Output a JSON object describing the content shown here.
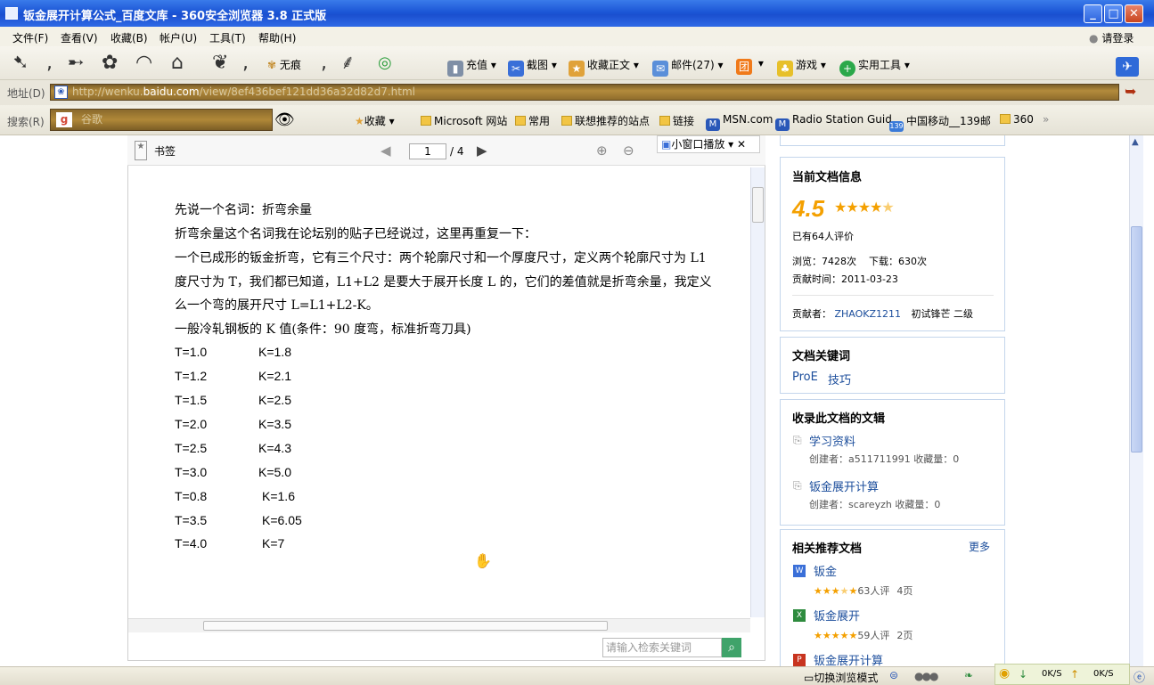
{
  "window": {
    "title": "钣金展开计算公式_百度文库 - 360安全浏览器 3.8 正式版",
    "minimize": "_",
    "maximize": "□",
    "close": "✕"
  },
  "menu": {
    "items": [
      "文件(F)",
      "查看(V)",
      "收藏(B)",
      "帐户(U)",
      "工具(T)",
      "帮助(H)"
    ],
    "login": "请登录"
  },
  "toolbar": {
    "no_trace": "无痕",
    "items": [
      "充值",
      "截图",
      "收藏正文",
      "邮件(27)",
      "团",
      "游戏",
      "实用工具"
    ]
  },
  "address": {
    "label": "地址(D)",
    "url_prefix": "http://wenku.",
    "url_host": "baidu.com",
    "url_path": "/view/8ef436bef121dd36a32d82d7.html"
  },
  "search": {
    "label": "搜索(R)",
    "engine": "谷歌"
  },
  "favorites": {
    "add": "收藏",
    "items": [
      "Microsoft 网站",
      "常用",
      "联想推荐的站点",
      "链接",
      "MSN.com",
      "Radio Station Guid",
      "中国移动__139邮",
      "360"
    ],
    "more": "»"
  },
  "doc_viewer": {
    "bookmark": "书签",
    "page_current": "1",
    "page_total": "/ 4",
    "mini_window": "小窗口播放",
    "search_placeholder": "请输入检索关键词",
    "lines": [
      "先说一个名词：折弯余量",
      "折弯余量这个名词我在论坛别的贴子已经说过，这里再重复一下：",
      "一个已成形的钣金折弯，它有三个尺寸：两个轮廓尺寸和一个厚度尺寸，定义两个轮廓尺寸为 L1",
      "度尺寸为 T，我们都已知道，L1+L2 是要大于展开长度 L 的，它们的差值就是折弯余量，我定义",
      "么一个弯的展开尺寸 L=L1+L2-K。",
      "一般冷轧钢板的 K 值(条件：90 度弯，标准折弯刀具)"
    ],
    "k_table": [
      {
        "t": "T=1.0",
        "k": "K=1.8"
      },
      {
        "t": "T=1.2",
        "k": "K=2.1"
      },
      {
        "t": "T=1.5",
        "k": "K=2.5"
      },
      {
        "t": "T=2.0",
        "k": "K=3.5"
      },
      {
        "t": "T=2.5",
        "k": "K=4.3"
      },
      {
        "t": "T=3.0",
        "k": "K=5.0"
      },
      {
        "t": "T=0.8",
        "k": "K=1.6"
      },
      {
        "t": "T=3.5",
        "k": "K=6.05"
      },
      {
        "t": "T=4.0",
        "k": "K=7"
      }
    ]
  },
  "sidebar": {
    "doc_info": {
      "title": "当前文档信息",
      "rating": "4.5",
      "rating_count": "已有64人评价",
      "views": "浏览：7428次",
      "downloads": "下载：630次",
      "contrib_time": "贡献时间：2011-03-23",
      "contributor_label": "贡献者：",
      "contributor": "ZHAOKZ1211",
      "contributor_level": "初试锋芒 二级"
    },
    "keywords": {
      "title": "文档关键词",
      "items": [
        "ProE",
        "技巧"
      ]
    },
    "collections": {
      "title": "收录此文档的文辑",
      "items": [
        {
          "name": "学习资料",
          "meta": "创建者：a511711991  收藏量：0"
        },
        {
          "name": "钣金展开计算",
          "meta": "创建者：scareyzh  收藏量：0"
        }
      ]
    },
    "related": {
      "title": "相关推荐文档",
      "more": "更多",
      "items": [
        {
          "name": "钣金",
          "stars": 3.5,
          "reviews": "63人评",
          "pages": "4页"
        },
        {
          "name": "钣金展开",
          "stars": 4,
          "reviews": "59人评",
          "pages": "2页"
        },
        {
          "name": "钣金展开计算",
          "stars": 0,
          "reviews": "",
          "pages": ""
        }
      ]
    }
  },
  "status": {
    "mode": "切换浏览模式",
    "down": "0K/S",
    "up": "0K/S"
  }
}
